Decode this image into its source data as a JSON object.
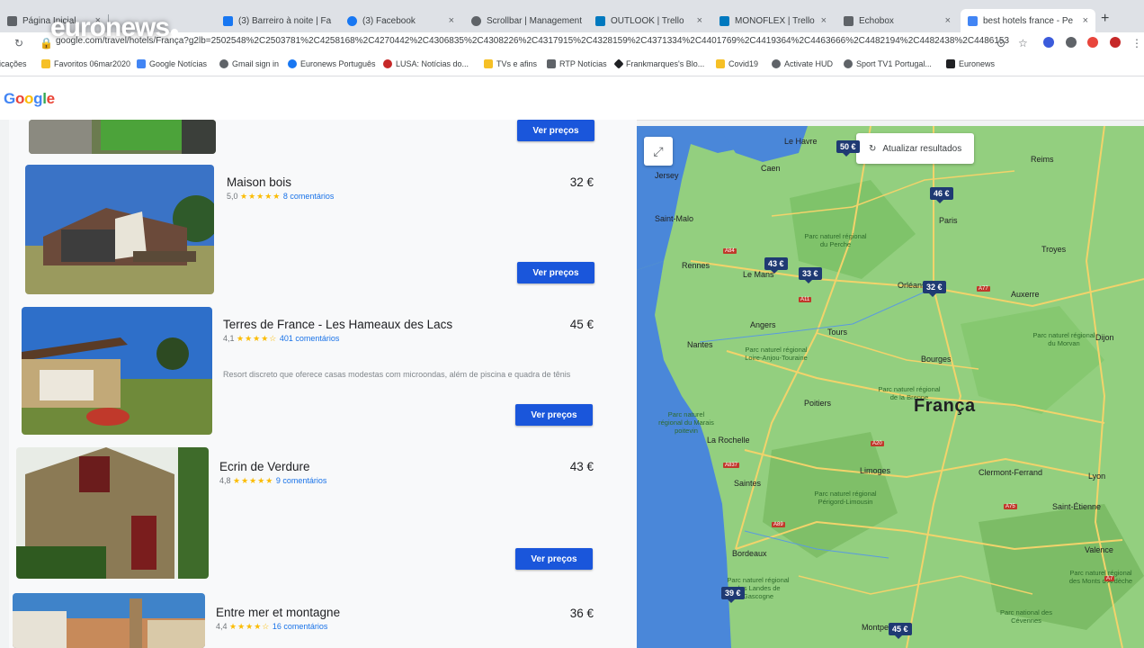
{
  "browser": {
    "tabs": [
      {
        "label": "Página Inicial",
        "favicon_color": "#5f6368"
      },
      {
        "label": "(3) Barreiro à noite | Fa",
        "favicon_color": "#1877f2"
      },
      {
        "label": "(3) Facebook",
        "favicon_color": "#1877f2"
      },
      {
        "label": "Scrollbar | Management",
        "favicon_color": "#5f6368"
      },
      {
        "label": "OUTLOOK | Trello",
        "favicon_color": "#0079bf"
      },
      {
        "label": "MONOFLEX | Trello",
        "favicon_color": "#0079bf"
      },
      {
        "label": "Echobox",
        "favicon_color": "#5f6368"
      },
      {
        "label": "best hotels france - Pe",
        "favicon_color": "#4285f4"
      }
    ],
    "url": "google.com/travel/hotels/França?g2lb=2502548%2C2503781%2C4258168%2C4270442%2C4306835%2C4308226%2C4317915%2C4328159%2C4371334%2C4401769%2C4419364%2C4463666%2C4482194%2C4482438%2C4486153",
    "bookmarks": [
      {
        "label": "plicações",
        "color": "#4285f4"
      },
      {
        "label": "Favoritos 06mar2020",
        "color": "#f6c026"
      },
      {
        "label": "Google Notícias",
        "color": "#4285f4"
      },
      {
        "label": "Gmail sign in",
        "color": "#5f6368"
      },
      {
        "label": "Euronews Português",
        "color": "#1877f2"
      },
      {
        "label": "LUSA: Notícias do...",
        "color": "#c62828"
      },
      {
        "label": "TVs e afins",
        "color": "#f6c026"
      },
      {
        "label": "RTP Notícias",
        "color": "#5f6368"
      },
      {
        "label": "Frankmarques's Blo...",
        "color": "#202124"
      },
      {
        "label": "Covid19",
        "color": "#f6c026"
      },
      {
        "label": "Activate HUD",
        "color": "#5f6368"
      },
      {
        "label": "Sport TV1 Portugal...",
        "color": "#5f6368"
      },
      {
        "label": "Euronews",
        "color": "#202124"
      }
    ]
  },
  "overlay": {
    "logo": "euronews"
  },
  "google": {
    "logo": "Google"
  },
  "results": {
    "button_label": "Ver preços",
    "hotels": [
      {
        "name": "Maison bois",
        "rating": "5,0",
        "reviews": "8 comentários",
        "price": "32 €",
        "description": ""
      },
      {
        "name": "Terres de France - Les Hameaux des Lacs",
        "rating": "4,1",
        "reviews": "401 comentários",
        "price": "45 €",
        "description": "Resort discreto que oferece casas modestas com microondas, além de piscina e quadra de tênis"
      },
      {
        "name": "Ecrin de Verdure",
        "rating": "4,8",
        "reviews": "9 comentários",
        "price": "43 €",
        "description": ""
      },
      {
        "name": "Entre mer et montagne",
        "rating": "4,4",
        "reviews": "16 comentários",
        "price": "36 €",
        "description": ""
      }
    ]
  },
  "map": {
    "refresh_label": "Atualizar resultados",
    "country": "França",
    "pins": [
      "50 €",
      "46 €",
      "43 €",
      "33 €",
      "32 €",
      "39 €",
      "45 €"
    ],
    "cities": [
      "Le Havre",
      "Caen",
      "Jersey",
      "Saint-Malo",
      "Rennes",
      "Le Mans",
      "Orléans",
      "Angers",
      "Tours",
      "Nantes",
      "Poitiers",
      "Bourges",
      "La Rochelle",
      "Limoges",
      "Clermont-Ferrand",
      "Lyon",
      "Bordeaux",
      "Saintes",
      "Saint-Étienne",
      "Valence",
      "Dijon",
      "Troyes",
      "Auxerre",
      "Montpellier",
      "Reims",
      "Paris"
    ],
    "parks": [
      "Parc naturel régional du Perche",
      "Parc naturel régional Loire-Anjou-Touraine",
      "Parc naturel régional de la Brenne",
      "Parc naturel régional du Morvan",
      "Parc naturel régional du Marais poitevin",
      "Parc naturel régional Périgord-Limousin",
      "Parc naturel régional des Landes de Gascogne",
      "Parc naturel régional des Monts d'Ardèche",
      "Parc national des Cévennes"
    ]
  }
}
